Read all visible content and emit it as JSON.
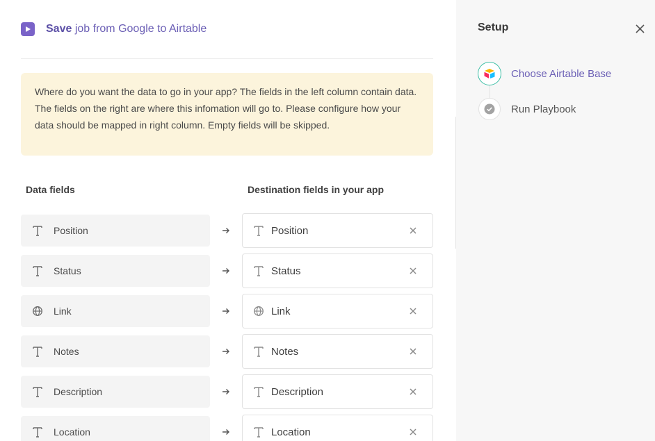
{
  "header": {
    "strong": "Save",
    "rest": " job from Google to Airtable"
  },
  "notice": {
    "text": "Where do you want the data to go in your app? The fields in the left column contain data. The fields on the right are where this infomation will go to. Please configure how your data should be mapped in right column. Empty fields will be skipped."
  },
  "columns": {
    "left": "Data fields",
    "right": "Destination fields in your app"
  },
  "rows": [
    {
      "source": "Position",
      "destination": "Position",
      "icon": "text-type-icon"
    },
    {
      "source": "Status",
      "destination": "Status",
      "icon": "text-type-icon"
    },
    {
      "source": "Link",
      "destination": "Link",
      "icon": "globe-icon"
    },
    {
      "source": "Notes",
      "destination": "Notes",
      "icon": "text-type-icon"
    },
    {
      "source": "Description",
      "destination": "Description",
      "icon": "text-type-icon"
    },
    {
      "source": "Location",
      "destination": "Location",
      "icon": "text-type-icon"
    }
  ],
  "side": {
    "title": "Setup",
    "steps": [
      {
        "label": "Choose Airtable Base",
        "state": "active"
      },
      {
        "label": "Run Playbook",
        "state": "pending"
      }
    ]
  },
  "colors": {
    "accent": "#6b5fb5",
    "notice_bg": "#fcf4dc",
    "active_ring": "#3dbfa6"
  }
}
